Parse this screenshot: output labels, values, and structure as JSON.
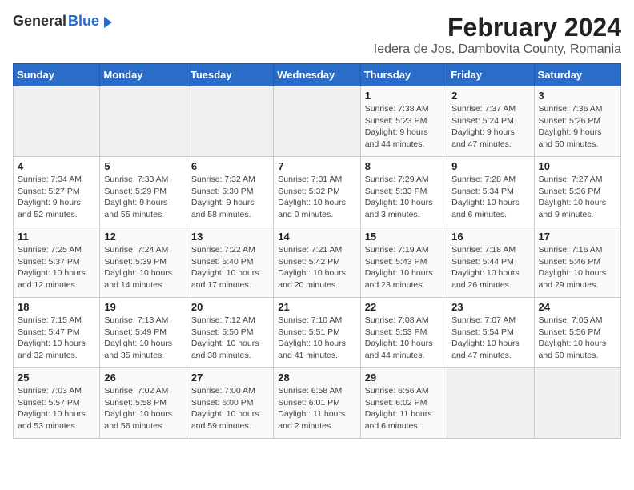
{
  "header": {
    "logo_general": "General",
    "logo_blue": "Blue",
    "title": "February 2024",
    "subtitle": "Iedera de Jos, Dambovita County, Romania"
  },
  "days_of_week": [
    "Sunday",
    "Monday",
    "Tuesday",
    "Wednesday",
    "Thursday",
    "Friday",
    "Saturday"
  ],
  "weeks": [
    [
      {
        "num": "",
        "info": ""
      },
      {
        "num": "",
        "info": ""
      },
      {
        "num": "",
        "info": ""
      },
      {
        "num": "",
        "info": ""
      },
      {
        "num": "1",
        "info": "Sunrise: 7:38 AM\nSunset: 5:23 PM\nDaylight: 9 hours\nand 44 minutes."
      },
      {
        "num": "2",
        "info": "Sunrise: 7:37 AM\nSunset: 5:24 PM\nDaylight: 9 hours\nand 47 minutes."
      },
      {
        "num": "3",
        "info": "Sunrise: 7:36 AM\nSunset: 5:26 PM\nDaylight: 9 hours\nand 50 minutes."
      }
    ],
    [
      {
        "num": "4",
        "info": "Sunrise: 7:34 AM\nSunset: 5:27 PM\nDaylight: 9 hours\nand 52 minutes."
      },
      {
        "num": "5",
        "info": "Sunrise: 7:33 AM\nSunset: 5:29 PM\nDaylight: 9 hours\nand 55 minutes."
      },
      {
        "num": "6",
        "info": "Sunrise: 7:32 AM\nSunset: 5:30 PM\nDaylight: 9 hours\nand 58 minutes."
      },
      {
        "num": "7",
        "info": "Sunrise: 7:31 AM\nSunset: 5:32 PM\nDaylight: 10 hours\nand 0 minutes."
      },
      {
        "num": "8",
        "info": "Sunrise: 7:29 AM\nSunset: 5:33 PM\nDaylight: 10 hours\nand 3 minutes."
      },
      {
        "num": "9",
        "info": "Sunrise: 7:28 AM\nSunset: 5:34 PM\nDaylight: 10 hours\nand 6 minutes."
      },
      {
        "num": "10",
        "info": "Sunrise: 7:27 AM\nSunset: 5:36 PM\nDaylight: 10 hours\nand 9 minutes."
      }
    ],
    [
      {
        "num": "11",
        "info": "Sunrise: 7:25 AM\nSunset: 5:37 PM\nDaylight: 10 hours\nand 12 minutes."
      },
      {
        "num": "12",
        "info": "Sunrise: 7:24 AM\nSunset: 5:39 PM\nDaylight: 10 hours\nand 14 minutes."
      },
      {
        "num": "13",
        "info": "Sunrise: 7:22 AM\nSunset: 5:40 PM\nDaylight: 10 hours\nand 17 minutes."
      },
      {
        "num": "14",
        "info": "Sunrise: 7:21 AM\nSunset: 5:42 PM\nDaylight: 10 hours\nand 20 minutes."
      },
      {
        "num": "15",
        "info": "Sunrise: 7:19 AM\nSunset: 5:43 PM\nDaylight: 10 hours\nand 23 minutes."
      },
      {
        "num": "16",
        "info": "Sunrise: 7:18 AM\nSunset: 5:44 PM\nDaylight: 10 hours\nand 26 minutes."
      },
      {
        "num": "17",
        "info": "Sunrise: 7:16 AM\nSunset: 5:46 PM\nDaylight: 10 hours\nand 29 minutes."
      }
    ],
    [
      {
        "num": "18",
        "info": "Sunrise: 7:15 AM\nSunset: 5:47 PM\nDaylight: 10 hours\nand 32 minutes."
      },
      {
        "num": "19",
        "info": "Sunrise: 7:13 AM\nSunset: 5:49 PM\nDaylight: 10 hours\nand 35 minutes."
      },
      {
        "num": "20",
        "info": "Sunrise: 7:12 AM\nSunset: 5:50 PM\nDaylight: 10 hours\nand 38 minutes."
      },
      {
        "num": "21",
        "info": "Sunrise: 7:10 AM\nSunset: 5:51 PM\nDaylight: 10 hours\nand 41 minutes."
      },
      {
        "num": "22",
        "info": "Sunrise: 7:08 AM\nSunset: 5:53 PM\nDaylight: 10 hours\nand 44 minutes."
      },
      {
        "num": "23",
        "info": "Sunrise: 7:07 AM\nSunset: 5:54 PM\nDaylight: 10 hours\nand 47 minutes."
      },
      {
        "num": "24",
        "info": "Sunrise: 7:05 AM\nSunset: 5:56 PM\nDaylight: 10 hours\nand 50 minutes."
      }
    ],
    [
      {
        "num": "25",
        "info": "Sunrise: 7:03 AM\nSunset: 5:57 PM\nDaylight: 10 hours\nand 53 minutes."
      },
      {
        "num": "26",
        "info": "Sunrise: 7:02 AM\nSunset: 5:58 PM\nDaylight: 10 hours\nand 56 minutes."
      },
      {
        "num": "27",
        "info": "Sunrise: 7:00 AM\nSunset: 6:00 PM\nDaylight: 10 hours\nand 59 minutes."
      },
      {
        "num": "28",
        "info": "Sunrise: 6:58 AM\nSunset: 6:01 PM\nDaylight: 11 hours\nand 2 minutes."
      },
      {
        "num": "29",
        "info": "Sunrise: 6:56 AM\nSunset: 6:02 PM\nDaylight: 11 hours\nand 6 minutes."
      },
      {
        "num": "",
        "info": ""
      },
      {
        "num": "",
        "info": ""
      }
    ]
  ]
}
